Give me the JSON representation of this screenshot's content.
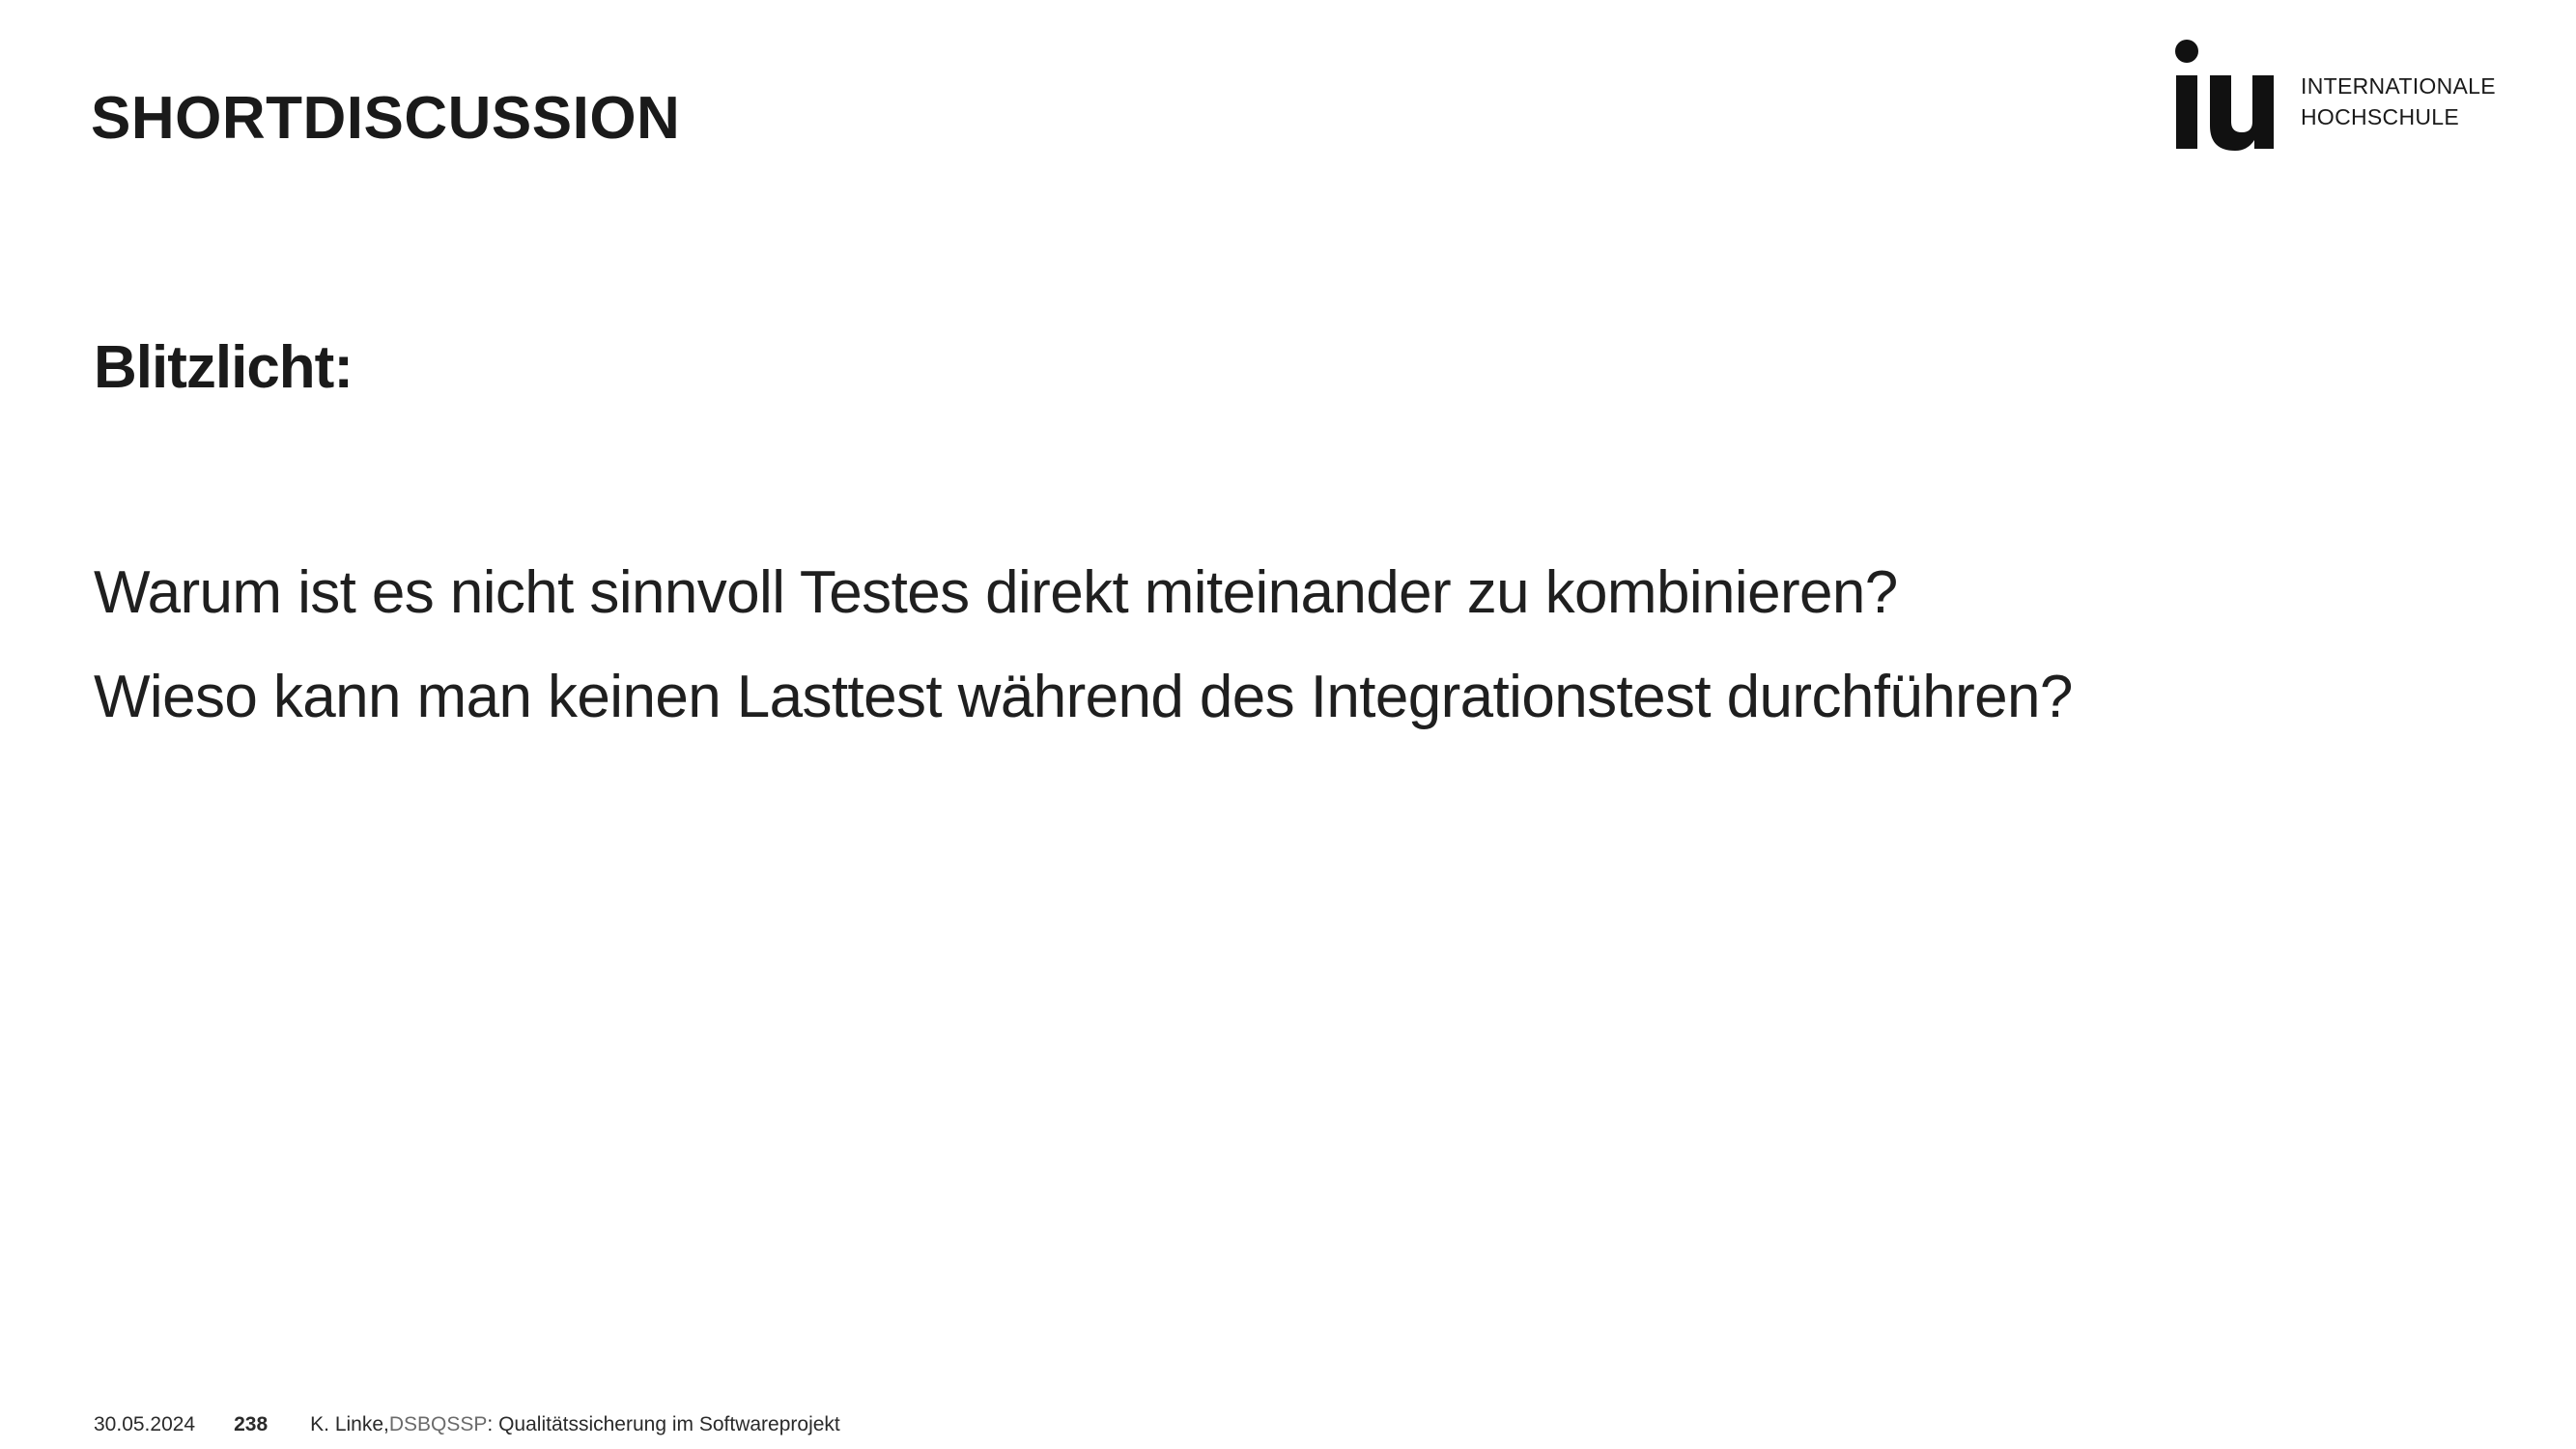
{
  "header": {
    "title": "SHORTDISCUSSION"
  },
  "logo": {
    "mark": "iu",
    "line1": "INTERNATIONALE",
    "line2": "HOCHSCHULE"
  },
  "content": {
    "heading": "Blitzlicht:",
    "questions": [
      "Warum ist es nicht sinnvoll Testes direkt miteinander zu kombinieren?",
      "Wieso kann man keinen Lasttest während des Integrationstest durchführen?"
    ]
  },
  "footer": {
    "date": "30.05.2024",
    "page": "238",
    "author": "K. Linke, ",
    "course_code": "DSBQSSP",
    "course_title": ": Qualitätssicherung im Softwareprojekt"
  }
}
